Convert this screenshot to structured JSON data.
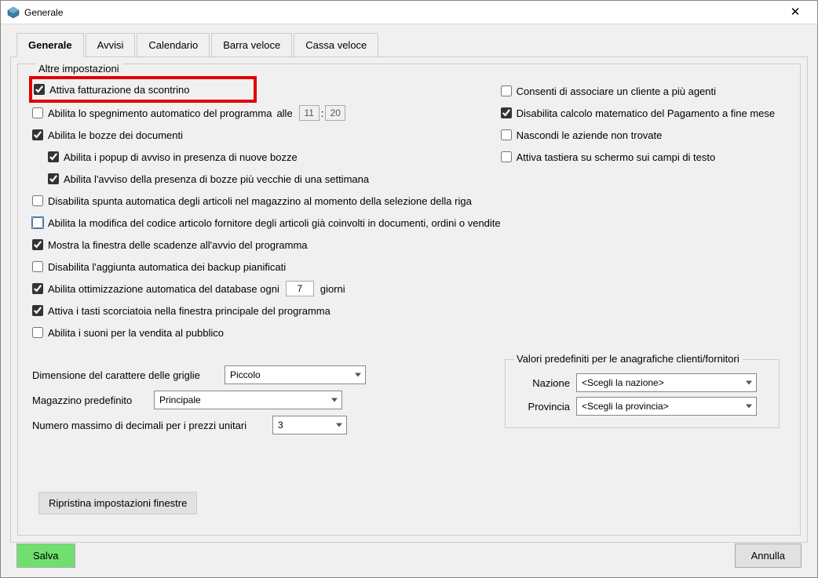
{
  "window": {
    "title": "Generale"
  },
  "tabs": [
    "Generale",
    "Avvisi",
    "Calendario",
    "Barra veloce",
    "Cassa veloce"
  ],
  "activeTab": 0,
  "section_label": "Altre impostazioni",
  "left": {
    "c1": "Attiva fatturazione da scontrino",
    "c2": "Abilita lo spegnimento automatico del programma",
    "c2_suffix": "alle",
    "c2_h": "11",
    "c2_m": "20",
    "c3": "Abilita le bozze dei documenti",
    "c3a": "Abilita i popup di avviso in presenza di nuove bozze",
    "c3b": "Abilita l'avviso della presenza di bozze più vecchie di una settimana",
    "c4": "Disabilita spunta automatica degli articoli nel magazzino al momento della selezione della riga",
    "c5": "Abilita la modifica del codice articolo fornitore degli articoli già coinvolti in documenti, ordini o vendite",
    "c6": "Mostra la finestra delle scadenze all'avvio del programma",
    "c7": "Disabilita l'aggiunta automatica dei backup pianificati",
    "c8a": "Abilita ottimizzazione automatica del database ogni",
    "c8_val": "7",
    "c8b": "giorni",
    "c9": "Attiva i tasti scorciatoia nella finestra principale del programma",
    "c10": "Abilita i suoni per la vendita al pubblico"
  },
  "right": {
    "r1": "Consenti di associare un cliente a più agenti",
    "r2": "Disabilita calcolo matematico del Pagamento a fine mese",
    "r3": "Nascondi le aziende non trovate",
    "r4": "Attiva tastiera su schermo sui campi di testo"
  },
  "form": {
    "font_label": "Dimensione del carattere delle griglie",
    "font_value": "Piccolo",
    "wh_label": "Magazzino predefinito",
    "wh_value": "Principale",
    "dec_label": "Numero massimo di decimali per i prezzi unitari",
    "dec_value": "3"
  },
  "defaults_group": {
    "title": "Valori predefiniti per le anagrafiche clienti/fornitori",
    "nation_label": "Nazione",
    "nation_value": "<Scegli la nazione>",
    "prov_label": "Provincia",
    "prov_value": "<Scegli la provincia>"
  },
  "buttons": {
    "reset": "Ripristina impostazioni finestre",
    "save": "Salva",
    "cancel": "Annulla"
  }
}
